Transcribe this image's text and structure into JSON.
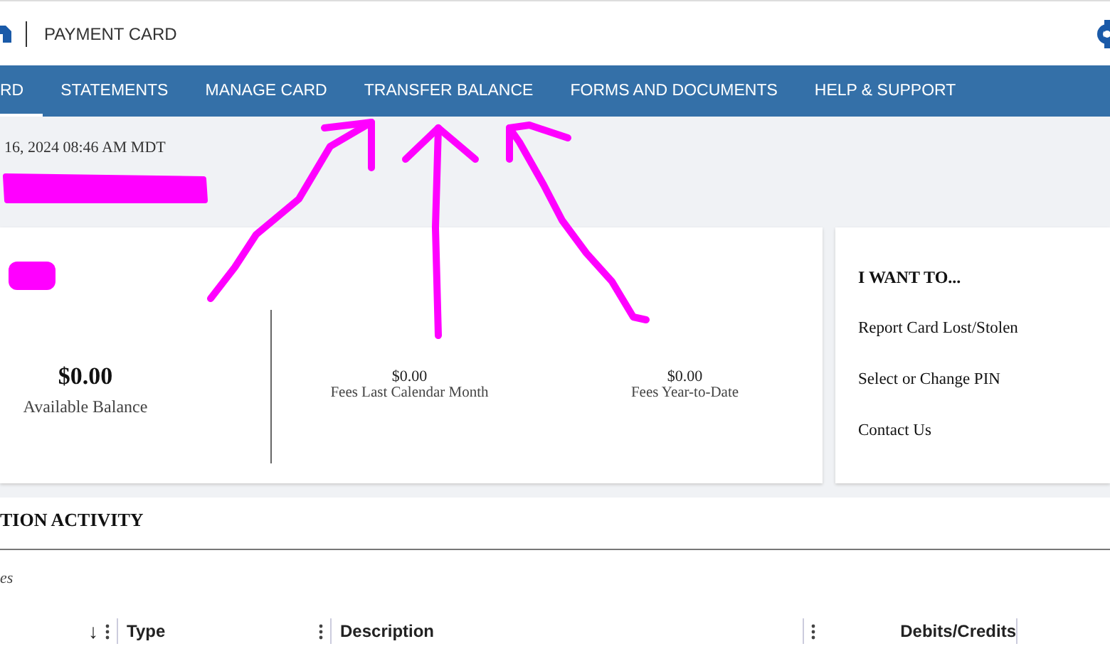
{
  "header": {
    "title": "PAYMENT CARD"
  },
  "nav": [
    {
      "label": "RD",
      "selected": true
    },
    {
      "label": "STATEMENTS",
      "selected": false
    },
    {
      "label": "MANAGE CARD",
      "selected": false
    },
    {
      "label": "TRANSFER BALANCE",
      "selected": false
    },
    {
      "label": "FORMS AND DOCUMENTS",
      "selected": false
    },
    {
      "label": "HELP & SUPPORT",
      "selected": false
    }
  ],
  "timestamp": "16, 2024 08:46 AM MDT",
  "balance": {
    "amount": "$0.00",
    "label": "Available Balance"
  },
  "fees": [
    {
      "amount": "$0.00",
      "label": "Fees Last Calendar Month"
    },
    {
      "amount": "$0.00",
      "label": "Fees Year-to-Date"
    }
  ],
  "actions": {
    "title": "I WANT TO...",
    "items": [
      "Report Card Lost/Stolen",
      "Select or Change PIN",
      "Contact Us"
    ]
  },
  "activity": {
    "title": "TION ACTIVITY",
    "note": "es",
    "columns": [
      {
        "label": "↓",
        "kind": "sort"
      },
      {
        "label": "Type",
        "kind": "text"
      },
      {
        "label": "Description",
        "kind": "text"
      },
      {
        "label": "Debits/Credits",
        "kind": "amount"
      }
    ]
  }
}
